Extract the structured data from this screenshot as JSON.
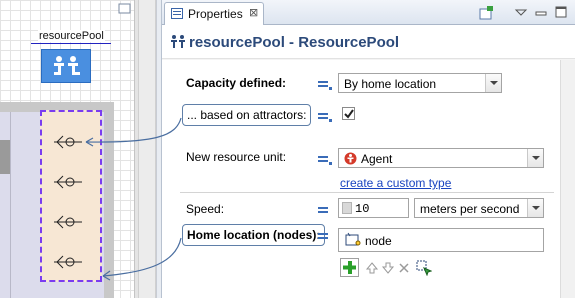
{
  "canvas": {
    "pool_label": "resourcePool"
  },
  "tab": {
    "label": "Properties",
    "close_glyph": "⊠"
  },
  "header": {
    "title": "resourcePool - ResourcePool"
  },
  "fields": {
    "capacity_defined": {
      "label": "Capacity defined:",
      "value": "By home location"
    },
    "based_on_attractors": {
      "label": "... based on attractors:",
      "checked": true
    },
    "new_resource_unit": {
      "label": "New resource unit:",
      "value": "Agent"
    },
    "create_link": "create a custom type",
    "speed": {
      "label": "Speed:",
      "value": "10",
      "unit": "meters per second"
    },
    "home_location": {
      "label": "Home location (nodes):",
      "items": [
        "node"
      ]
    }
  },
  "colors": {
    "accent": "#2c4a7a",
    "link": "#1a44c0",
    "node_area_fill": "#f7e7d4",
    "node_area_border": "#7a3cf0",
    "pool_icon_fill": "#4a8fe0"
  }
}
